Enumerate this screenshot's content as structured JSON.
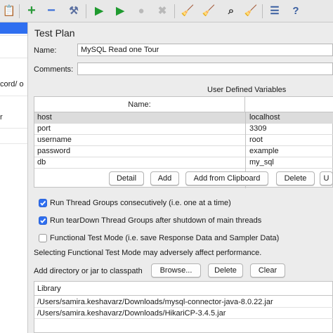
{
  "toolbar": {
    "buttons": [
      {
        "name": "templates-icon",
        "glyph": "📋",
        "color": "#b07a2a"
      },
      {
        "name": "add-icon",
        "glyph": "+",
        "color": "#2a9a3a"
      },
      {
        "name": "remove-icon",
        "glyph": "−",
        "color": "#3a6fd8"
      },
      {
        "name": "toggle-icon",
        "glyph": "⚒",
        "color": "#5a6fa0"
      },
      {
        "name": "start-icon",
        "glyph": "▶",
        "color": "#1f9a2f"
      },
      {
        "name": "start-no-pauses-icon",
        "glyph": "▶",
        "color": "#1f9a2f"
      },
      {
        "name": "stop-icon",
        "glyph": "●",
        "color": "#b9b9b9"
      },
      {
        "name": "shutdown-icon",
        "glyph": "✖",
        "color": "#b9b9b9"
      },
      {
        "name": "clear-icon",
        "glyph": "🧹",
        "color": "#b07a2a"
      },
      {
        "name": "clear-all-icon",
        "glyph": "🧹",
        "color": "#b07a2a"
      },
      {
        "name": "search-binoculars-icon",
        "glyph": "⌕",
        "color": "#333333"
      },
      {
        "name": "reset-search-broom-icon",
        "glyph": "🧹",
        "color": "#d4a017"
      },
      {
        "name": "function-helper-icon",
        "glyph": "☰",
        "color": "#3a5fa0"
      },
      {
        "name": "help-icon",
        "glyph": "?",
        "color": "#3a5fa0"
      }
    ]
  },
  "tree": {
    "rows": [
      {
        "text": "",
        "selected": true
      },
      {
        "text": "",
        "selected": false
      },
      {
        "text": "",
        "selected": false
      },
      {
        "text": "cord/ o",
        "selected": false
      },
      {
        "text": "",
        "selected": false
      },
      {
        "text": "r",
        "selected": false
      }
    ]
  },
  "panel": {
    "title": "Test Plan",
    "name_label": "Name:",
    "name_value": "MySQL Read one Tour",
    "comments_label": "Comments:",
    "comments_value": ""
  },
  "variables": {
    "title": "User Defined Variables",
    "header_name": "Name:",
    "header_value": "",
    "rows": [
      {
        "name": "host",
        "value": "localhost"
      },
      {
        "name": "port",
        "value": "3309"
      },
      {
        "name": "username",
        "value": "root"
      },
      {
        "name": "password",
        "value": "example"
      },
      {
        "name": "db",
        "value": "my_sql"
      }
    ]
  },
  "var_buttons": {
    "detail": "Detail",
    "add": "Add",
    "add_clipboard": "Add from Clipboard",
    "delete": "Delete",
    "up": "U"
  },
  "options": {
    "serialize": {
      "label": "Run Thread Groups consecutively (i.e. one at a time)",
      "checked": true
    },
    "teardown": {
      "label": "Run tearDown Thread Groups after shutdown of main threads",
      "checked": true
    },
    "functional": {
      "label": "Functional Test Mode (i.e. save Response Data and Sampler Data)",
      "checked": false
    },
    "warning": "Selecting Functional Test Mode may adversely affect performance."
  },
  "classpath": {
    "label": "Add directory or jar to classpath",
    "browse": "Browse...",
    "delete": "Delete",
    "clear": "Clear",
    "list_header": "Library",
    "entries": [
      "/Users/samira.keshavarz/Downloads/mysql-connector-java-8.0.22.jar",
      "/Users/samira.keshavarz/Downloads/HikariCP-3.4.5.jar"
    ]
  },
  "colors": {
    "accent": "#2f6ff0",
    "highlight_row": "#dcdcdc"
  }
}
